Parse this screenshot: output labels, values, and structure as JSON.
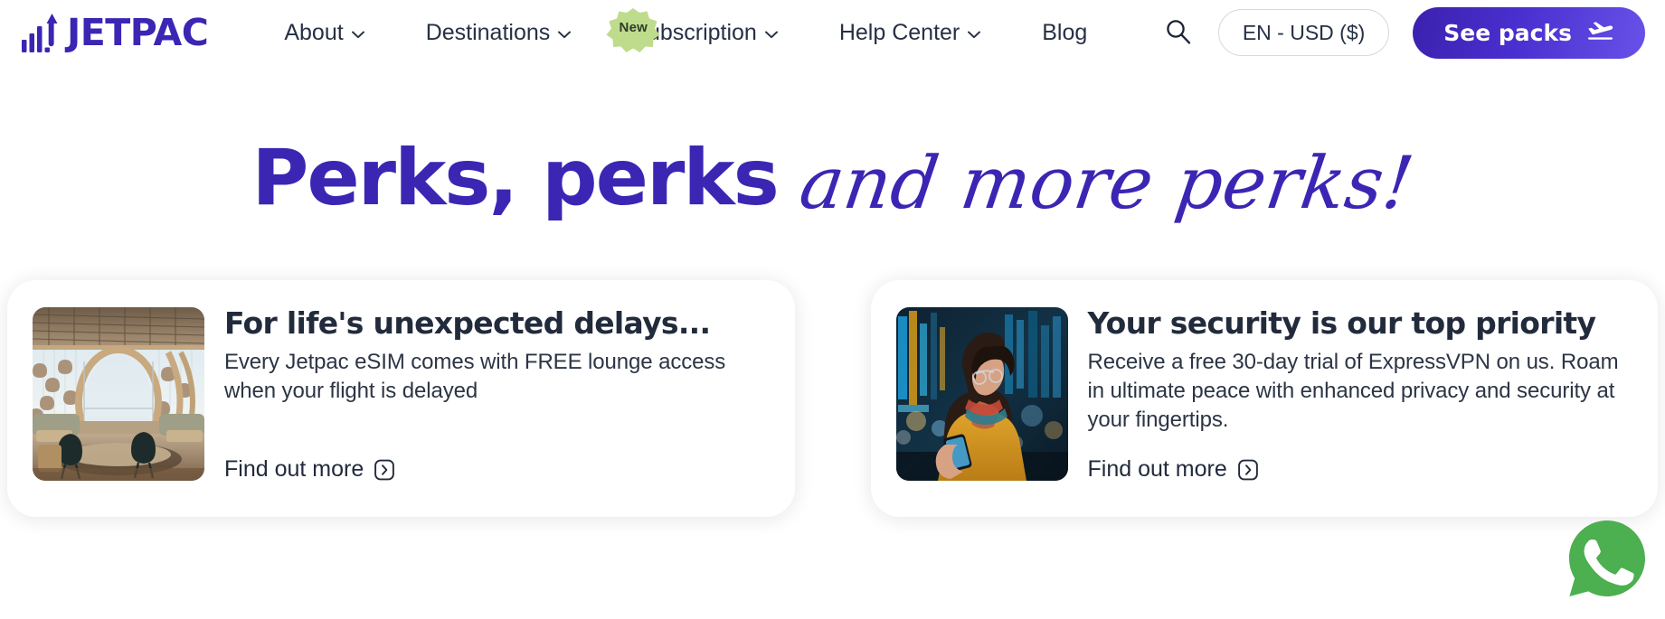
{
  "brand": {
    "name": "JETPAC",
    "logo_icon": "bar-chart-arrow-icon",
    "primary_color": "#3B26B4"
  },
  "header": {
    "nav": [
      {
        "label": "About",
        "has_caret": true,
        "badge": null
      },
      {
        "label": "Destinations",
        "has_caret": true,
        "badge": null
      },
      {
        "label": "Subscription",
        "has_caret": true,
        "badge": "New"
      },
      {
        "label": "Help Center",
        "has_caret": true,
        "badge": null
      },
      {
        "label": "Blog",
        "has_caret": false,
        "badge": null
      }
    ],
    "search_icon": "search-icon",
    "currency_selector": "EN - USD ($)",
    "cta": {
      "label": "See packs",
      "icon": "plane-takeoff-icon",
      "gradient_from": "#3B21AE",
      "gradient_to": "#6752E8"
    },
    "badge_color": "#BEDC8B"
  },
  "hero": {
    "title_bold": "Perks, perks",
    "title_script": "and more perks!",
    "color": "#3B26B4"
  },
  "cards": [
    {
      "image_alt": "airport-lounge-photo",
      "title": "For life's unexpected delays...",
      "description": "Every Jetpac eSIM comes with FREE lounge access when your flight is delayed",
      "link_label": "Find out more",
      "link_icon": "chevron-right-boxed-icon"
    },
    {
      "image_alt": "woman-using-phone-in-airport-photo",
      "title": "Your security is our top priority",
      "description": "Receive a free 30-day trial of ExpressVPN on us. Roam in ultimate peace with enhanced privacy and security at your fingertips.",
      "link_label": "Find out more",
      "link_icon": "chevron-right-boxed-icon"
    }
  ],
  "floating_action": {
    "icon": "whatsapp-icon",
    "color": "#4CAF50"
  }
}
